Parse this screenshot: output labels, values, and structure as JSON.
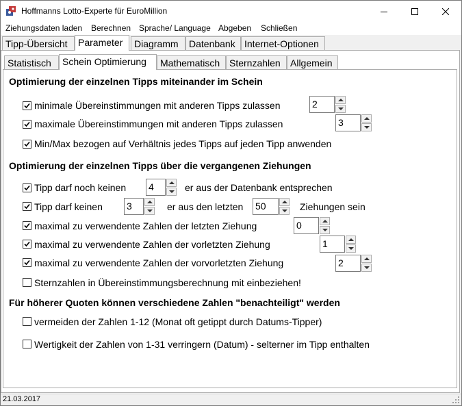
{
  "window": {
    "title": "Hoffmanns Lotto-Experte  für EuroMillion"
  },
  "menu": [
    "Ziehungsdaten laden",
    "Berechnen",
    "Sprache/ Language",
    "Abgeben",
    "Schließen"
  ],
  "tabs": [
    "Tipp-Übersicht",
    "Parameter",
    "Diagramm",
    "Datenbank",
    "Internet-Optionen"
  ],
  "subtabs": [
    "Statistisch",
    "Schein Optimierung",
    "Mathematisch",
    "Sternzahlen",
    "Allgemein"
  ],
  "section1": {
    "heading": "Optimierung der einzelnen Tipps miteinander im Schein",
    "min_label": "minimale Übereinstimmungen mit anderen Tipps zulassen",
    "min_value": "2",
    "max_label": "maximale Übereinstimmungen mit anderen Tipps zulassen",
    "max_value": "3",
    "minmax_label": "Min/Max bezogen auf Verhältnis jedes Tipps auf jeden Tipp anwenden"
  },
  "section2": {
    "heading": "Optimierung der einzelnen Tipps über die vergangenen Ziehungen",
    "row1_label_a": "Tipp darf noch keinen",
    "row1_value": "4",
    "row1_label_b": "er aus der Datenbank entsprechen",
    "row2_label_a": "Tipp darf keinen",
    "row2_value_a": "3",
    "row2_label_b": "er aus den letzten",
    "row2_value_b": "50",
    "row2_label_c": "Ziehungen sein",
    "row3_label": "maximal zu verwendente Zahlen der letzten Ziehung",
    "row3_value": "0",
    "row4_label": "maximal zu verwendente Zahlen der vorletzten Ziehung",
    "row4_value": "1",
    "row5_label": "maximal zu verwendente Zahlen der vorvorletzten Ziehung",
    "row5_value": "2",
    "row6_label": "Sternzahlen in Übereinstimmungsberechnung mit einbeziehen!"
  },
  "section3": {
    "heading": "Für höherer Quoten können verschiedene Zahlen  \"benachteiligt\" werden",
    "opt1_label": "vermeiden der Zahlen 1-12 (Monat oft getippt durch Datums-Tipper)",
    "opt2_label": "Wertigkeit der Zahlen von 1-31 verringern (Datum)  -  selterner im Tipp enthalten"
  },
  "statusbar": {
    "text": "21.03.2017"
  }
}
